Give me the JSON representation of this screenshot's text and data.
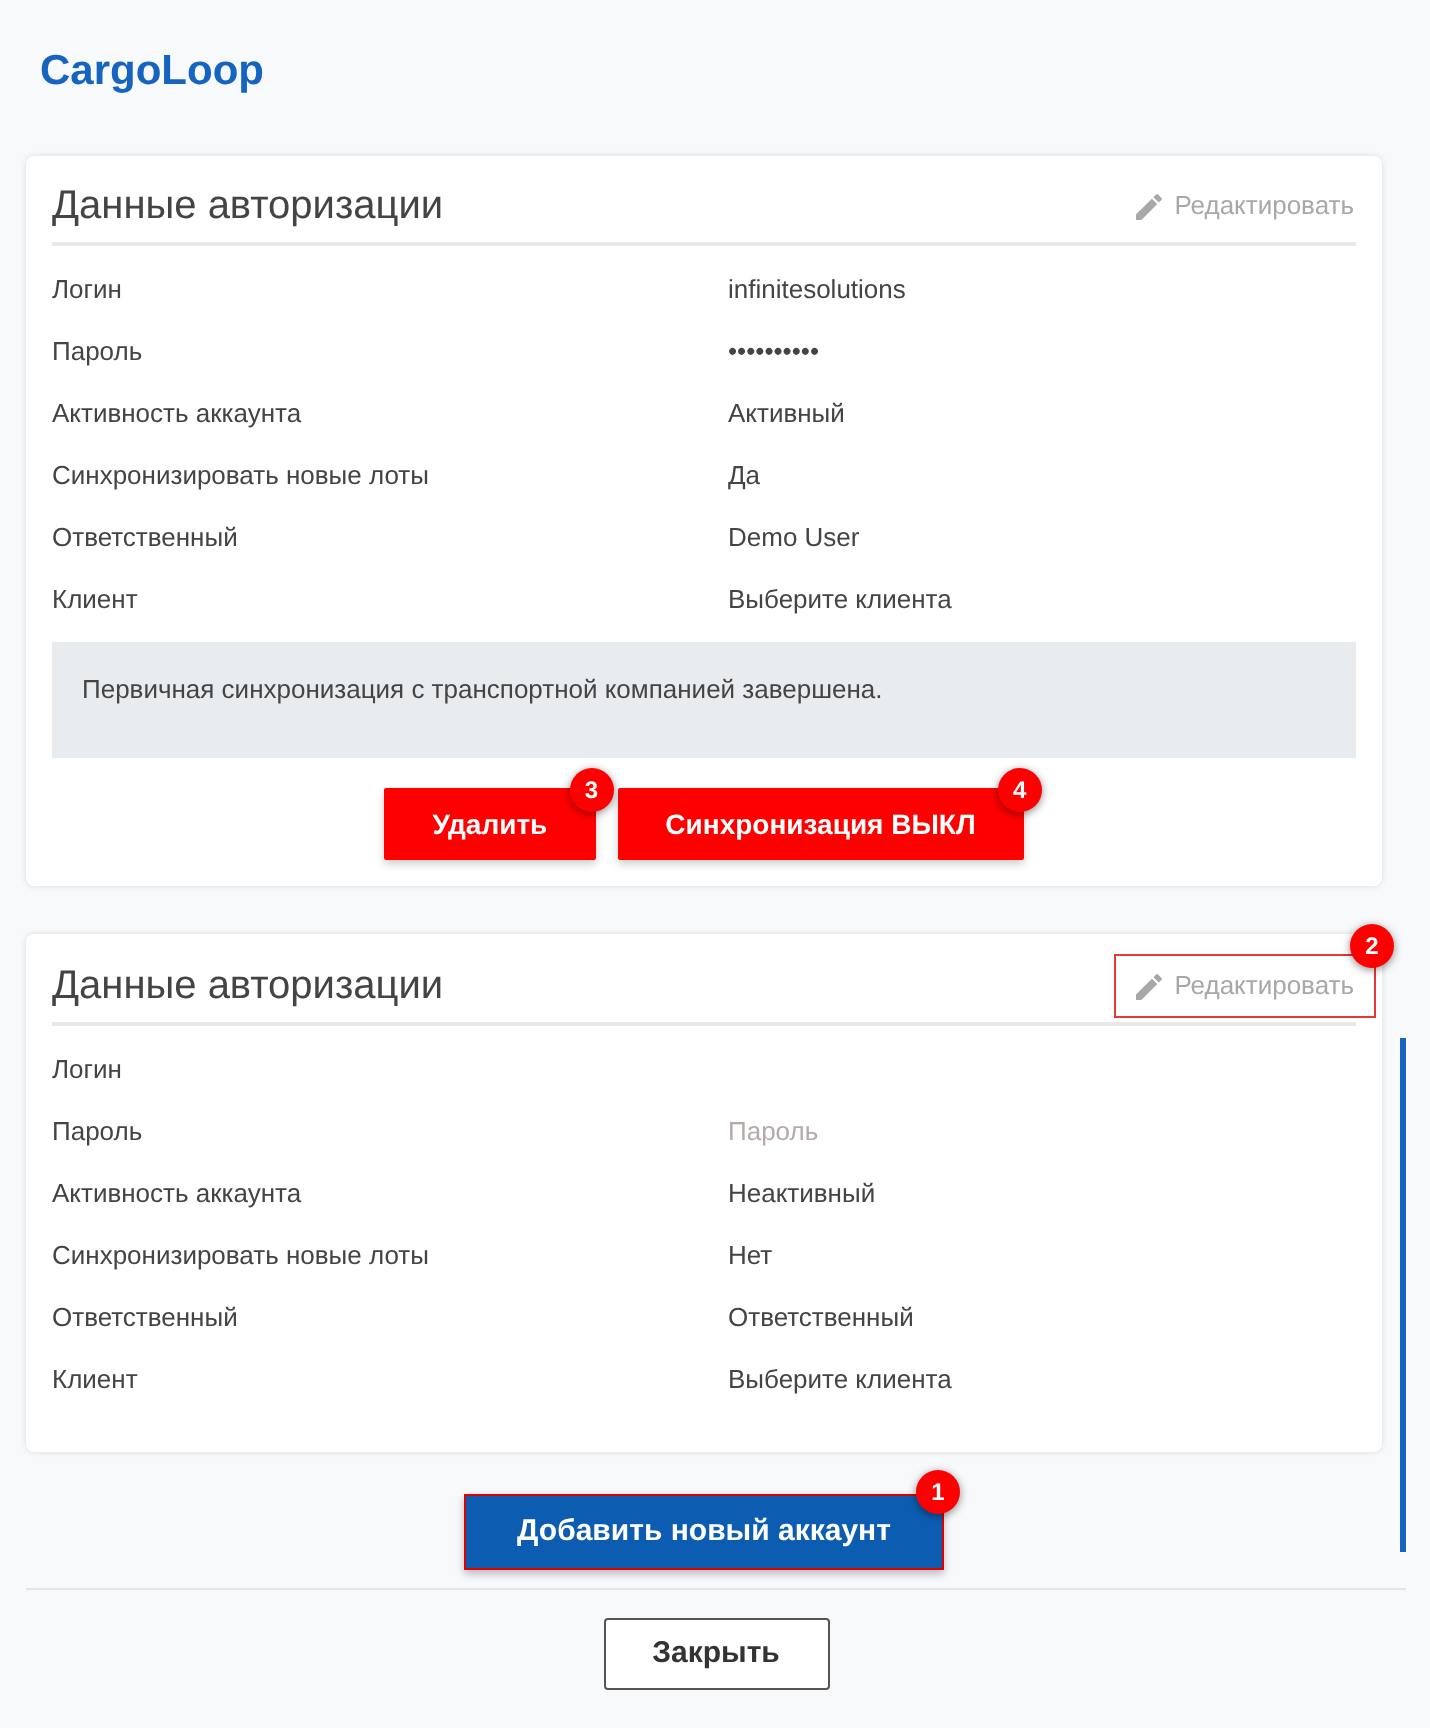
{
  "app": {
    "title": "CargoLoop"
  },
  "cards": [
    {
      "title": "Данные авторизации",
      "edit": {
        "label": "Редактировать",
        "highlighted": false
      },
      "fields": [
        {
          "label": "Логин",
          "value": "infinitesolutions"
        },
        {
          "label": "Пароль",
          "value": "••••••••••"
        },
        {
          "label": "Активность аккаунта",
          "value": "Активный"
        },
        {
          "label": "Синхронизировать новые лоты",
          "value": "Да"
        },
        {
          "label": "Ответственный",
          "value": "Demo User"
        },
        {
          "label": "Клиент",
          "value": "Выберите клиента"
        }
      ],
      "notice": "Первичная синхронизация с транспортной компанией завершена.",
      "buttons": [
        {
          "label": "Удалить",
          "badge": "3"
        },
        {
          "label": "Синхронизация ВЫКЛ",
          "badge": "4"
        }
      ]
    },
    {
      "title": "Данные авторизации",
      "edit": {
        "label": "Редактировать",
        "highlighted": true,
        "badge": "2"
      },
      "fields": [
        {
          "label": "Логин"
        },
        {
          "label": "Пароль",
          "placeholder": "Пароль"
        },
        {
          "label": "Активность аккаунта",
          "value": "Неактивный"
        },
        {
          "label": "Синхронизировать новые лоты",
          "value": "Нет"
        },
        {
          "label": "Ответственный",
          "value": "Ответственный"
        },
        {
          "label": "Клиент",
          "value": "Выберите клиента"
        }
      ]
    }
  ],
  "add_button": {
    "label": "Добавить новый аккаунт",
    "highlighted": true,
    "badge": "1"
  },
  "close_button": {
    "label": "Закрыть"
  }
}
